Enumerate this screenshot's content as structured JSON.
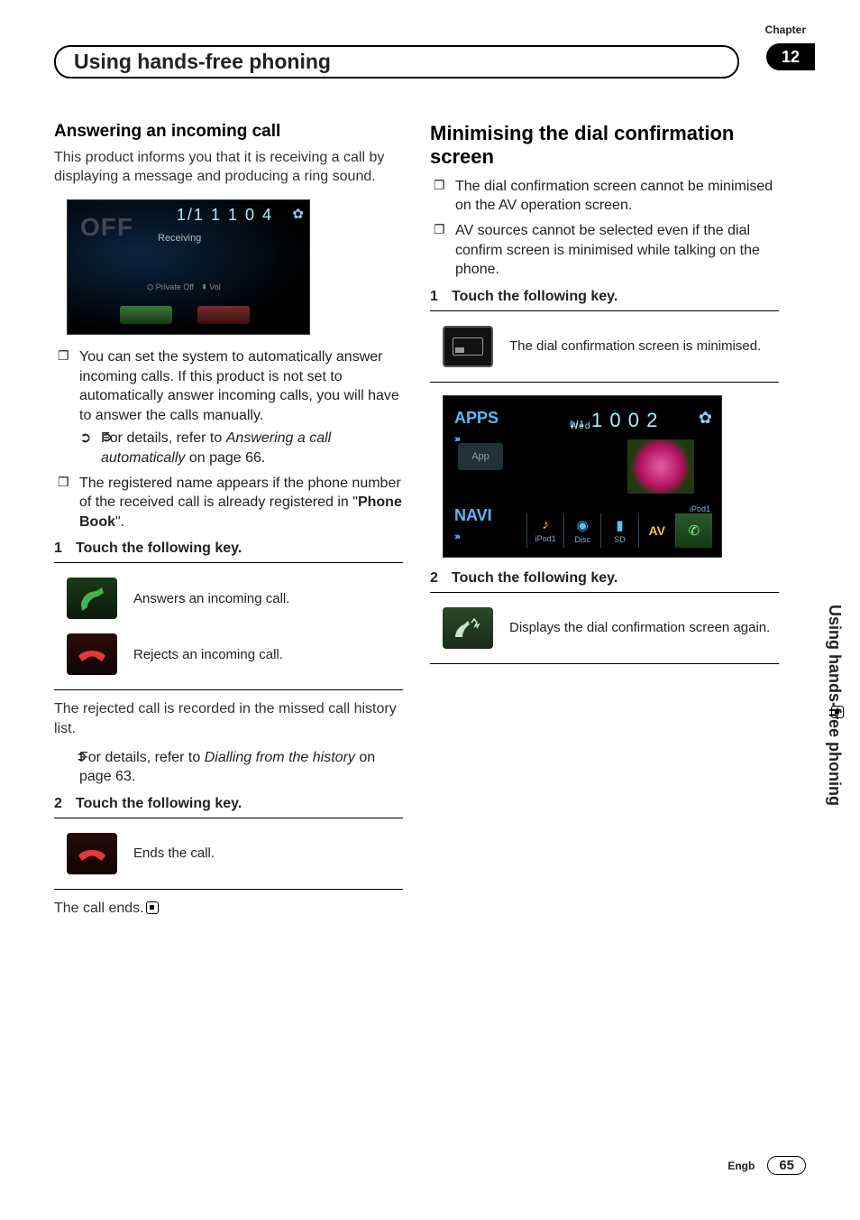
{
  "header": {
    "chapter_label": "Chapter",
    "chapter_number": "12",
    "title": "Using hands-free phoning"
  },
  "left": {
    "h3": "Answering an incoming call",
    "intro": "This product informs you that it is receiving a call by displaying a message and producing a ring sound.",
    "ss1": {
      "off": "OFF",
      "time": "1/1 1 1  0 4",
      "receiving": "Receiving",
      "private": "Private Off",
      "vol": "Vol"
    },
    "b1": "You can set the system to automatically answer incoming calls. If this product is not set to automatically answer incoming calls, you will have to answer the calls manually.",
    "b1_ref_pre": "For details, refer to ",
    "b1_ref_it": "Answering a call automatically",
    "b1_ref_post": " on page 66.",
    "b2_pre": "The registered name appears if the phone number of the received call is already registered in \"",
    "b2_bold": "Phone Book",
    "b2_post": "\".",
    "step1": "Touch the following key.",
    "row1": "Answers an incoming call.",
    "row2": "Rejects an incoming call.",
    "after_reject": "The rejected call is recorded in the missed call history list.",
    "ref2_pre": "For details, refer to ",
    "ref2_it": "Dialling from the history",
    "ref2_post": " on page 63.",
    "step2": "Touch the following key.",
    "row3": "Ends the call.",
    "call_ends": "The call ends."
  },
  "right": {
    "h2": "Minimising the dial confirmation screen",
    "b1": "The dial confirmation screen cannot be minimised on the AV operation screen.",
    "b2": "AV sources cannot be selected even if the dial confirm screen is minimised while talking on the phone.",
    "step1": "Touch the following key.",
    "row1": "The dial confirmation screen is minimised.",
    "ss2": {
      "apps": "APPS",
      "app": "App",
      "time_day": "1/1",
      "time_wday": "Wed",
      "time_main": "1 0  0 2",
      "navi": "NAVI",
      "ipod": "iPod1",
      "disc": "Disc",
      "sd": "SD",
      "av": "AV",
      "ipod_lbl": "iPod1"
    },
    "step2": "Touch the following key.",
    "row2": "Displays the dial confirmation screen again."
  },
  "side_tab": "Using hands-free phoning",
  "footer": {
    "lang": "Engb",
    "page": "65"
  }
}
